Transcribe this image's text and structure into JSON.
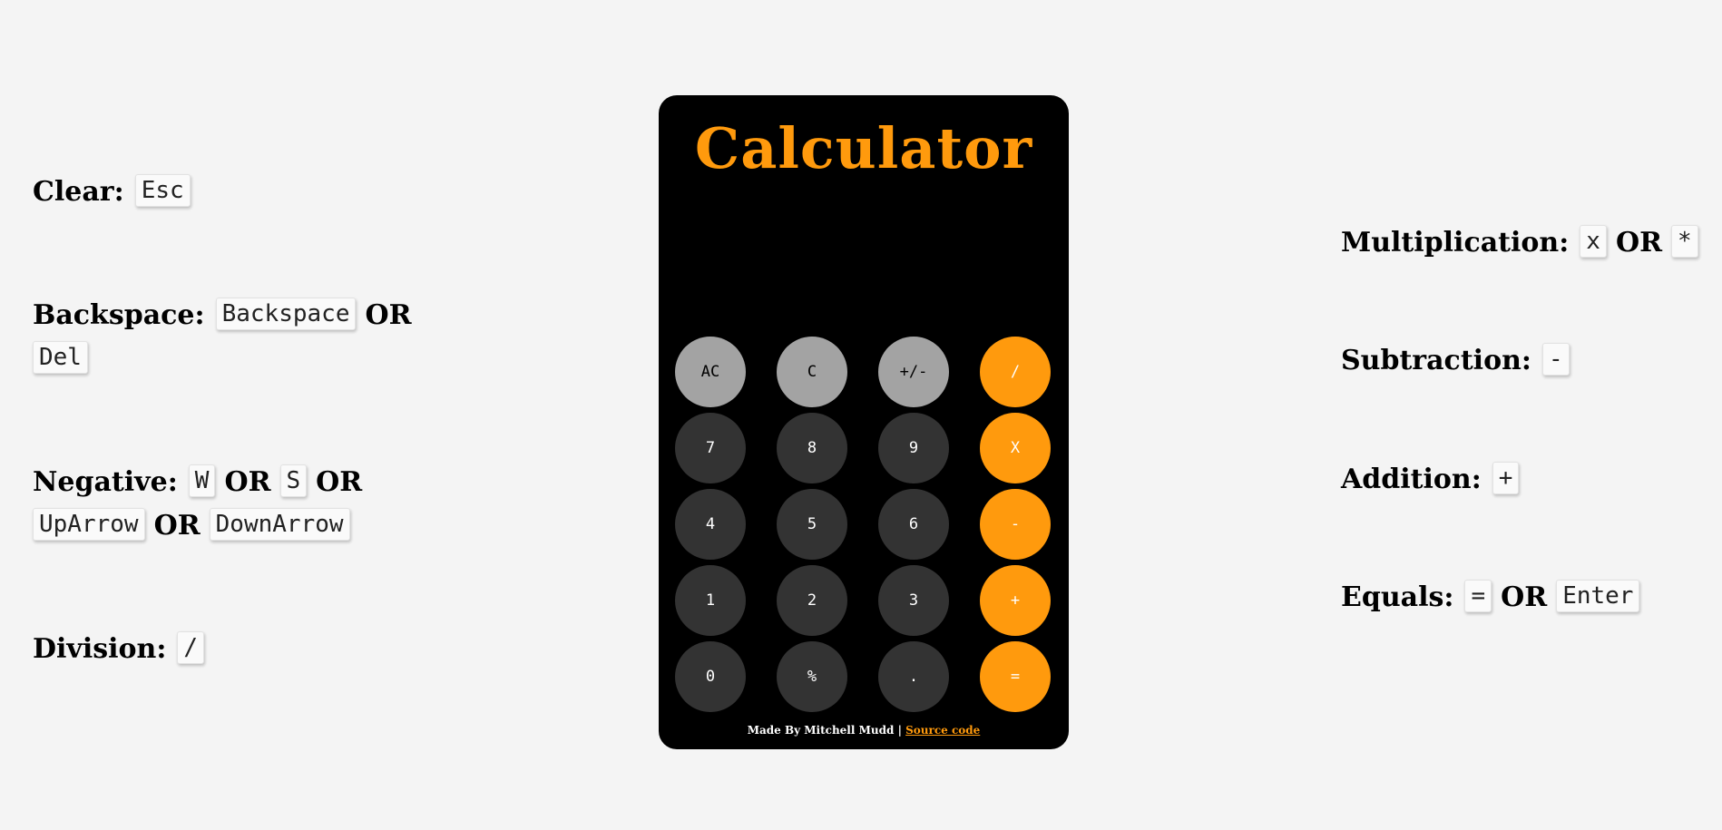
{
  "calculator": {
    "title": "Calculator",
    "display_value": "",
    "colors": {
      "accent": "#ff9a0d",
      "function_button": "#a3a3a3",
      "number_button": "#333333",
      "body": "#000000",
      "page_background": "#f4f4f4"
    },
    "buttons": [
      [
        "AC",
        "C",
        "+/-",
        "/"
      ],
      [
        "7",
        "8",
        "9",
        "X"
      ],
      [
        "4",
        "5",
        "6",
        "-"
      ],
      [
        "1",
        "2",
        "3",
        "+"
      ],
      [
        "0",
        "%",
        ".",
        "="
      ]
    ],
    "footer": {
      "text": "Made By Mitchell Mudd | ",
      "link_text": "Source code"
    }
  },
  "shortcuts_left": {
    "clear": {
      "label": "Clear:",
      "keys": [
        "Esc"
      ]
    },
    "backspace": {
      "label": "Backspace:",
      "keys": [
        "Backspace",
        "Del"
      ],
      "or": "OR"
    },
    "negative": {
      "label": "Negative:",
      "keys": [
        "W",
        "S",
        "UpArrow",
        "DownArrow"
      ],
      "or": "OR"
    },
    "division": {
      "label": "Division:",
      "keys": [
        "/"
      ]
    }
  },
  "shortcuts_right": {
    "multiplication": {
      "label": "Multiplication:",
      "keys": [
        "x",
        "*"
      ],
      "or": "OR"
    },
    "subtraction": {
      "label": "Subtraction:",
      "keys": [
        "-"
      ]
    },
    "addition": {
      "label": "Addition:",
      "keys": [
        "+"
      ]
    },
    "equals": {
      "label": "Equals:",
      "keys": [
        "=",
        "Enter"
      ],
      "or": "OR"
    }
  }
}
